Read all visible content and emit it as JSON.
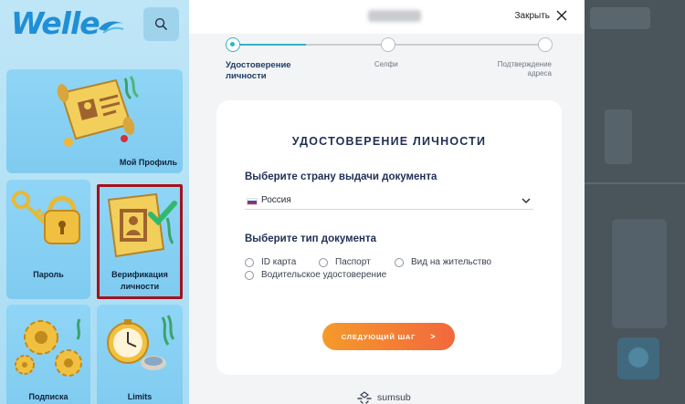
{
  "sidebar": {
    "logo": "Welle",
    "tiles": [
      {
        "label": "Мой Профиль"
      },
      {
        "label": "Пароль"
      },
      {
        "label": "Верификация личности"
      },
      {
        "label": "Подписка"
      },
      {
        "label": "Limits"
      }
    ]
  },
  "modal": {
    "close_label": "Закрыть",
    "steps": [
      {
        "label": "Удостоверение личности",
        "state": "active"
      },
      {
        "label": "Селфи",
        "state": "pending"
      },
      {
        "label": "Подтверждение адреса",
        "state": "pending"
      }
    ],
    "card": {
      "title": "УДОСТОВЕРЕНИЕ ЛИЧНОСТИ",
      "country_label": "Выберите страну выдачи документа",
      "country_value": "Россия",
      "doc_type_label": "Выберите тип документа",
      "doc_types": [
        "ID карта",
        "Паспорт",
        "Вид на жительство",
        "Водительское удостоверение"
      ],
      "next_button": "СЛЕДУЮЩИЙ ШАГ",
      "next_arrow": ">"
    },
    "powered_by": "sumsub"
  },
  "colors": {
    "accent_teal": "#2fb4c7",
    "button_gradient_start": "#f59a2b",
    "button_gradient_end": "#f2683c",
    "heading_navy": "#1f2f55",
    "logo_blue": "#1f8fd6",
    "selection_border": "#a3121d"
  },
  "icons": [
    "search-icon",
    "close-icon",
    "chevron-down-icon",
    "russia-flag-icon",
    "sumsub-logo-icon"
  ]
}
